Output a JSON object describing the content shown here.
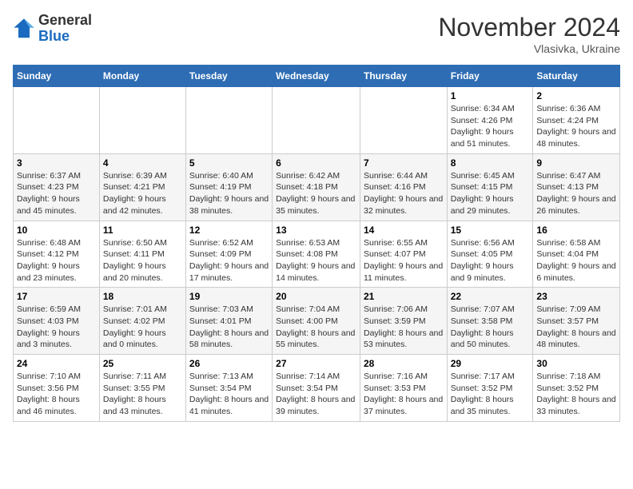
{
  "logo": {
    "general": "General",
    "blue": "Blue"
  },
  "title": "November 2024",
  "location": "Vlasivka, Ukraine",
  "weekdays": [
    "Sunday",
    "Monday",
    "Tuesday",
    "Wednesday",
    "Thursday",
    "Friday",
    "Saturday"
  ],
  "weeks": [
    [
      {
        "day": "",
        "info": ""
      },
      {
        "day": "",
        "info": ""
      },
      {
        "day": "",
        "info": ""
      },
      {
        "day": "",
        "info": ""
      },
      {
        "day": "",
        "info": ""
      },
      {
        "day": "1",
        "info": "Sunrise: 6:34 AM\nSunset: 4:26 PM\nDaylight: 9 hours and 51 minutes."
      },
      {
        "day": "2",
        "info": "Sunrise: 6:36 AM\nSunset: 4:24 PM\nDaylight: 9 hours and 48 minutes."
      }
    ],
    [
      {
        "day": "3",
        "info": "Sunrise: 6:37 AM\nSunset: 4:23 PM\nDaylight: 9 hours and 45 minutes."
      },
      {
        "day": "4",
        "info": "Sunrise: 6:39 AM\nSunset: 4:21 PM\nDaylight: 9 hours and 42 minutes."
      },
      {
        "day": "5",
        "info": "Sunrise: 6:40 AM\nSunset: 4:19 PM\nDaylight: 9 hours and 38 minutes."
      },
      {
        "day": "6",
        "info": "Sunrise: 6:42 AM\nSunset: 4:18 PM\nDaylight: 9 hours and 35 minutes."
      },
      {
        "day": "7",
        "info": "Sunrise: 6:44 AM\nSunset: 4:16 PM\nDaylight: 9 hours and 32 minutes."
      },
      {
        "day": "8",
        "info": "Sunrise: 6:45 AM\nSunset: 4:15 PM\nDaylight: 9 hours and 29 minutes."
      },
      {
        "day": "9",
        "info": "Sunrise: 6:47 AM\nSunset: 4:13 PM\nDaylight: 9 hours and 26 minutes."
      }
    ],
    [
      {
        "day": "10",
        "info": "Sunrise: 6:48 AM\nSunset: 4:12 PM\nDaylight: 9 hours and 23 minutes."
      },
      {
        "day": "11",
        "info": "Sunrise: 6:50 AM\nSunset: 4:11 PM\nDaylight: 9 hours and 20 minutes."
      },
      {
        "day": "12",
        "info": "Sunrise: 6:52 AM\nSunset: 4:09 PM\nDaylight: 9 hours and 17 minutes."
      },
      {
        "day": "13",
        "info": "Sunrise: 6:53 AM\nSunset: 4:08 PM\nDaylight: 9 hours and 14 minutes."
      },
      {
        "day": "14",
        "info": "Sunrise: 6:55 AM\nSunset: 4:07 PM\nDaylight: 9 hours and 11 minutes."
      },
      {
        "day": "15",
        "info": "Sunrise: 6:56 AM\nSunset: 4:05 PM\nDaylight: 9 hours and 9 minutes."
      },
      {
        "day": "16",
        "info": "Sunrise: 6:58 AM\nSunset: 4:04 PM\nDaylight: 9 hours and 6 minutes."
      }
    ],
    [
      {
        "day": "17",
        "info": "Sunrise: 6:59 AM\nSunset: 4:03 PM\nDaylight: 9 hours and 3 minutes."
      },
      {
        "day": "18",
        "info": "Sunrise: 7:01 AM\nSunset: 4:02 PM\nDaylight: 9 hours and 0 minutes."
      },
      {
        "day": "19",
        "info": "Sunrise: 7:03 AM\nSunset: 4:01 PM\nDaylight: 8 hours and 58 minutes."
      },
      {
        "day": "20",
        "info": "Sunrise: 7:04 AM\nSunset: 4:00 PM\nDaylight: 8 hours and 55 minutes."
      },
      {
        "day": "21",
        "info": "Sunrise: 7:06 AM\nSunset: 3:59 PM\nDaylight: 8 hours and 53 minutes."
      },
      {
        "day": "22",
        "info": "Sunrise: 7:07 AM\nSunset: 3:58 PM\nDaylight: 8 hours and 50 minutes."
      },
      {
        "day": "23",
        "info": "Sunrise: 7:09 AM\nSunset: 3:57 PM\nDaylight: 8 hours and 48 minutes."
      }
    ],
    [
      {
        "day": "24",
        "info": "Sunrise: 7:10 AM\nSunset: 3:56 PM\nDaylight: 8 hours and 46 minutes."
      },
      {
        "day": "25",
        "info": "Sunrise: 7:11 AM\nSunset: 3:55 PM\nDaylight: 8 hours and 43 minutes."
      },
      {
        "day": "26",
        "info": "Sunrise: 7:13 AM\nSunset: 3:54 PM\nDaylight: 8 hours and 41 minutes."
      },
      {
        "day": "27",
        "info": "Sunrise: 7:14 AM\nSunset: 3:54 PM\nDaylight: 8 hours and 39 minutes."
      },
      {
        "day": "28",
        "info": "Sunrise: 7:16 AM\nSunset: 3:53 PM\nDaylight: 8 hours and 37 minutes."
      },
      {
        "day": "29",
        "info": "Sunrise: 7:17 AM\nSunset: 3:52 PM\nDaylight: 8 hours and 35 minutes."
      },
      {
        "day": "30",
        "info": "Sunrise: 7:18 AM\nSunset: 3:52 PM\nDaylight: 8 hours and 33 minutes."
      }
    ]
  ]
}
